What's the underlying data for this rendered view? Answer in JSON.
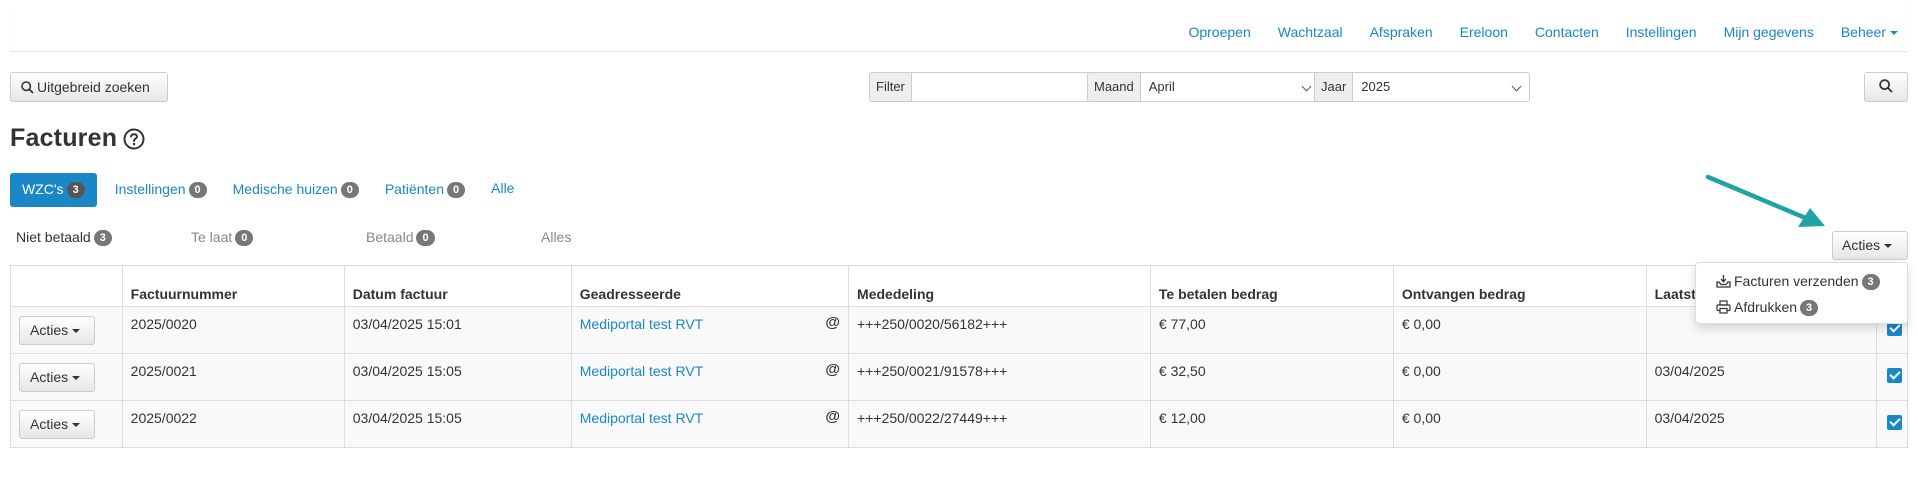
{
  "nav": {
    "items": [
      "Oproepen",
      "Wachtzaal",
      "Afspraken",
      "Ereloon",
      "Contacten",
      "Instellingen",
      "Mijn gegevens"
    ],
    "admin_label": "Beheer"
  },
  "search": {
    "advanced_label": "Uitgebreid zoeken",
    "filter_label": "Filter",
    "filter_value": "",
    "month_label": "Maand",
    "month_value": "April",
    "year_label": "Jaar",
    "year_value": "2025"
  },
  "page": {
    "title": "Facturen"
  },
  "tabs": [
    {
      "label": "WZC's",
      "count": "3",
      "active": true
    },
    {
      "label": "Instellingen",
      "count": "0"
    },
    {
      "label": "Medische huizen",
      "count": "0"
    },
    {
      "label": "Patiënten",
      "count": "0"
    },
    {
      "label": "Alle",
      "count": ""
    }
  ],
  "subtabs": [
    {
      "label": "Niet betaald",
      "count": "3"
    },
    {
      "label": "Te laat",
      "count": "0"
    },
    {
      "label": "Betaald",
      "count": "0"
    },
    {
      "label": "Alles",
      "count": ""
    }
  ],
  "actions": {
    "label": "Acties",
    "menu": [
      {
        "label": "Facturen verzenden",
        "count": "3",
        "icon": "inbox-send-icon"
      },
      {
        "label": "Afdrukken",
        "count": "3",
        "icon": "printer-icon"
      }
    ]
  },
  "table": {
    "headers": [
      "",
      "Factuurnummer",
      "Datum factuur",
      "Geadresseerde",
      "Mededeling",
      "Te betalen bedrag",
      "Ontvangen bedrag",
      "Laatst",
      ""
    ],
    "rows": [
      {
        "action": "Acties",
        "number": "2025/0020",
        "date": "03/04/2025 15:01",
        "addressee": "Mediportal test RVT",
        "at": "@",
        "message": "+++250/0020/56182+++",
        "due": "€ 77,00",
        "received": "€ 0,00",
        "last": ""
      },
      {
        "action": "Acties",
        "number": "2025/0021",
        "date": "03/04/2025 15:05",
        "addressee": "Mediportal test RVT",
        "at": "@",
        "message": "+++250/0021/91578+++",
        "due": "€ 32,50",
        "received": "€ 0,00",
        "last": "03/04/2025"
      },
      {
        "action": "Acties",
        "number": "2025/0022",
        "date": "03/04/2025 15:05",
        "addressee": "Mediportal test RVT",
        "at": "@",
        "message": "+++250/0022/27449+++",
        "due": "€ 12,00",
        "received": "€ 0,00",
        "last": "03/04/2025"
      }
    ]
  },
  "colors": {
    "accent": "#1a87c7",
    "badge": "#777777",
    "arrow": "#1fa3a3"
  }
}
